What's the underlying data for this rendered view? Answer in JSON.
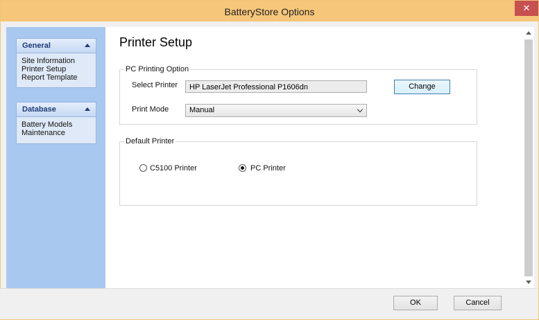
{
  "window": {
    "title": "BatteryStore Options",
    "close_glyph": "✕"
  },
  "nav": {
    "groups": [
      {
        "title": "General",
        "items": [
          "Site Information",
          "Printer Setup",
          "Report Template"
        ]
      },
      {
        "title": "Database",
        "items": [
          "Battery Models",
          "Maintenance"
        ]
      }
    ]
  },
  "page": {
    "title": "Printer Setup"
  },
  "pc_printing": {
    "legend": "PC Printing Option",
    "select_printer_label": "Select Printer",
    "select_printer_value": "HP LaserJet Professional P1606dn",
    "change_button": "Change",
    "print_mode_label": "Print Mode",
    "print_mode_value": "Manual"
  },
  "default_printer": {
    "legend": "Default Printer",
    "options": [
      {
        "label": "C5100  Printer",
        "selected": false
      },
      {
        "label": "PC Printer",
        "selected": true
      }
    ]
  },
  "footer": {
    "ok": "OK",
    "cancel": "Cancel"
  },
  "colors": {
    "titlebar": "#f6c67a",
    "close": "#c75050",
    "nav_pane": "#a9c8f0",
    "nav_title": "#1e3c78"
  }
}
